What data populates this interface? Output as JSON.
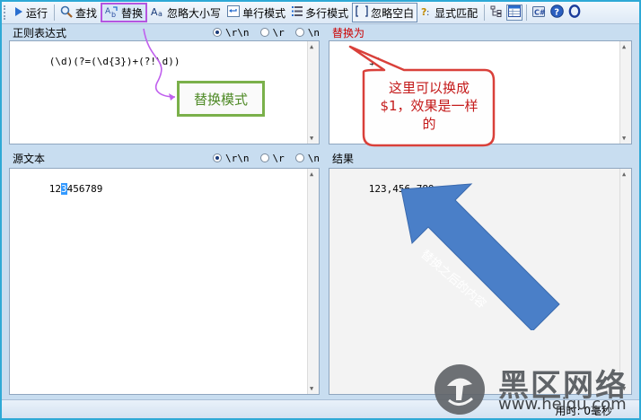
{
  "toolbar": {
    "run_label": "运行",
    "find_label": "查找",
    "replace_label": "替换",
    "ignore_case_label": "忽略大小写",
    "single_line_label": "单行模式",
    "multi_line_label": "多行模式",
    "ignore_whitespace_label": "忽略空白",
    "explicit_capture_label": "显式匹配"
  },
  "regex_pane": {
    "title": "正则表达式",
    "options": [
      "\\r\\n",
      "\\r",
      "\\n"
    ],
    "value": "(\\d)(?=(\\d{3})+(?!\\d))"
  },
  "replace_pane": {
    "title": "替换为",
    "value": "$0,"
  },
  "source_pane": {
    "title": "源文本",
    "options": [
      "\\r\\n",
      "\\r",
      "\\n"
    ],
    "value_before": "12",
    "value_selected": "3",
    "value_after": "456789"
  },
  "result_pane": {
    "title": "结果",
    "value": "123,456,789"
  },
  "status": {
    "elapsed": "用时: 0毫秒"
  },
  "annotations": {
    "green": "替换模式",
    "red_line1": "这里可以换成",
    "red_line2": "$1，效果是一样",
    "red_line3": "的",
    "blue": "替换之后的内容"
  },
  "watermark": {
    "text": "黑区网络",
    "url": "www.heiqu.com"
  },
  "colors": {
    "window_border": "#2ea9d6",
    "toolbar_highlight": "#b455e0",
    "replace_title": "#cc0000",
    "green_box": "#7ab04a",
    "red_callout": "#d9403a",
    "blue_arrow": "#4a7fc8"
  }
}
